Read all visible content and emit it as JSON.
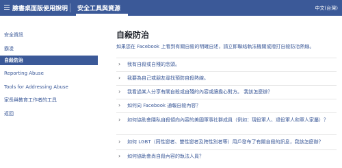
{
  "topbar": {
    "brand": "臉書桌面版使用說明",
    "tab": "安全工具與資源",
    "language": "中文(台灣)"
  },
  "sidebar": {
    "items": [
      {
        "label": "安全資訊",
        "active": false
      },
      {
        "label": "霸凌",
        "active": false
      },
      {
        "label": "自殺防治",
        "active": true
      },
      {
        "label": "Reporting Abuse",
        "active": false
      },
      {
        "label": "Tools for Addressing Abuse",
        "active": false
      },
      {
        "label": "家長與教育工作者的工具",
        "active": false
      },
      {
        "label": "返回",
        "active": false
      }
    ]
  },
  "main": {
    "title": "自殺防治",
    "intro": "如果您在 Facebook 上看到有關自殺的明確自述，請立即聯絡執法機關或撥打自殺防治熱線。",
    "faqs": [
      "我有自殺或自殘的念頭。",
      "我要為自己或朋友尋找預防自殺熱線。",
      "我看過某人分享有關自殺或自殘的內容或讓擔心對方。 我該怎麼辦？",
      "如何向 Facebook 通報自殺內容？",
      "如何協助會隱私自殺傾向內容的美國軍事社群成員（例如：現役軍人、退役軍人和軍人家屬）？",
      "如何 LGBT（同性戀者、雙性戀者及跨性別者等）用戶發布了有關自殺的訊息，我該怎麼辦？",
      "如何協助會尚自殺內容的執法人員？"
    ]
  }
}
